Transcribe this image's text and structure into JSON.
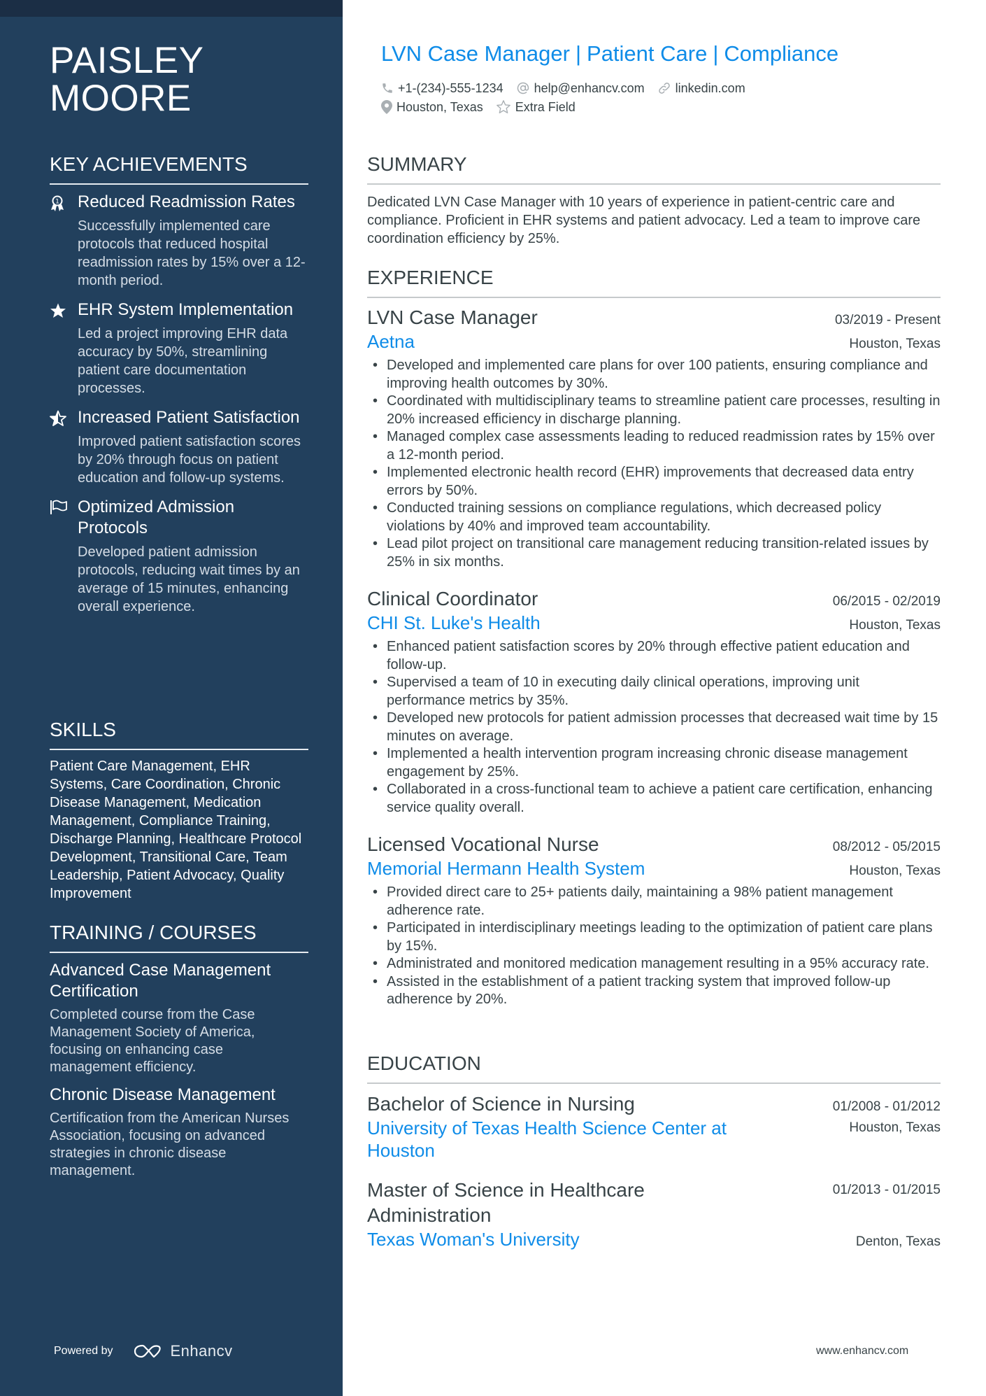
{
  "sidebar": {
    "name_line1": "PAISLEY",
    "name_line2": "MOORE",
    "key_achievements": {
      "title": "KEY ACHIEVEMENTS",
      "items": [
        {
          "icon": "award-ribbon-icon",
          "title": "Reduced Readmission Rates",
          "description": "Successfully implemented care protocols that reduced hospital readmission rates by 15% over a 12-month period."
        },
        {
          "icon": "star-filled-icon",
          "title": "EHR System Implementation",
          "description": "Led a project improving EHR data accuracy by 50%, streamlining patient care documentation processes."
        },
        {
          "icon": "star-half-icon",
          "title": "Increased Patient Satisfaction",
          "description": "Improved patient satisfaction scores by 20% through focus on patient education and follow-up systems."
        },
        {
          "icon": "flag-icon",
          "title": "Optimized Admission Protocols",
          "description": "Developed patient admission protocols, reducing wait times by an average of 15 minutes, enhancing overall experience."
        }
      ]
    },
    "skills": {
      "title": "SKILLS",
      "text": "Patient Care Management, EHR Systems, Care Coordination, Chronic Disease Management, Medication Management, Compliance Training, Discharge Planning, Healthcare Protocol Development, Transitional Care, Team Leadership, Patient Advocacy, Quality Improvement"
    },
    "training": {
      "title": "TRAINING / COURSES",
      "items": [
        {
          "title": "Advanced Case Management Certification",
          "description": "Completed course from the Case Management Society of America, focusing on enhancing case management efficiency."
        },
        {
          "title": "Chronic Disease Management",
          "description": "Certification from the American Nurses Association, focusing on advanced strategies in chronic disease management."
        }
      ]
    },
    "powered_by": "Powered by",
    "brand": "Enhancv"
  },
  "header": {
    "headline_parts": [
      "LVN Case Manager",
      "Patient Care",
      "Compliance"
    ],
    "separator": "|",
    "phone": "+1-(234)-555-1234",
    "email": "help@enhancv.com",
    "website": "linkedin.com",
    "location": "Houston, Texas",
    "extra": "Extra Field"
  },
  "summary": {
    "title": "SUMMARY",
    "text": "Dedicated LVN Case Manager with 10 years of experience in patient-centric care and compliance. Proficient in EHR systems and patient advocacy. Led a team to improve care coordination efficiency by 25%."
  },
  "experience": {
    "title": "EXPERIENCE",
    "jobs": [
      {
        "title": "LVN Case Manager",
        "dates": "03/2019 - Present",
        "company": "Aetna",
        "location": "Houston, Texas",
        "bullets": [
          "Developed and implemented care plans for over 100 patients, ensuring compliance and improving health outcomes by 30%.",
          "Coordinated with multidisciplinary teams to streamline patient care processes, resulting in 20% increased efficiency in discharge planning.",
          "Managed complex case assessments leading to reduced readmission rates by 15% over a 12-month period.",
          "Implemented electronic health record (EHR) improvements that decreased data entry errors by 50%.",
          "Conducted training sessions on compliance regulations, which decreased policy violations by 40% and improved team accountability.",
          "Lead pilot project on transitional care management reducing transition-related issues by 25% in six months."
        ]
      },
      {
        "title": "Clinical Coordinator",
        "dates": "06/2015 - 02/2019",
        "company": "CHI St. Luke's Health",
        "location": "Houston, Texas",
        "bullets": [
          "Enhanced patient satisfaction scores by 20% through effective patient education and follow-up.",
          "Supervised a team of 10 in executing daily clinical operations, improving unit performance metrics by 35%.",
          "Developed new protocols for patient admission processes that decreased wait time by 15 minutes on average.",
          "Implemented a health intervention program increasing chronic disease management engagement by 25%.",
          "Collaborated in a cross-functional team to achieve a patient care certification, enhancing service quality overall."
        ]
      },
      {
        "title": "Licensed Vocational Nurse",
        "dates": "08/2012 - 05/2015",
        "company": "Memorial Hermann Health System",
        "location": "Houston, Texas",
        "bullets": [
          "Provided direct care to 25+ patients daily, maintaining a 98% patient management adherence rate.",
          "Participated in interdisciplinary meetings leading to the optimization of patient care plans by 15%.",
          "Administrated and monitored medication management resulting in a 95% accuracy rate.",
          "Assisted in the establishment of a patient tracking system that improved follow-up adherence by 20%."
        ]
      }
    ]
  },
  "education": {
    "title": "EDUCATION",
    "items": [
      {
        "degree": "Bachelor of Science in Nursing",
        "dates": "01/2008 - 01/2012",
        "school": "University of Texas Health Science Center at Houston",
        "location": "Houston, Texas"
      },
      {
        "degree": "Master of Science in Healthcare Administration",
        "dates": "01/2013 - 01/2015",
        "school": "Texas Woman's University",
        "location": "Denton, Texas"
      }
    ]
  },
  "footer": {
    "url": "www.enhancv.com"
  },
  "colors": {
    "sidebar_bg": "#22405d",
    "sidebar_top": "#1b2e45",
    "accent": "#0f8ce8",
    "text": "#384347"
  }
}
